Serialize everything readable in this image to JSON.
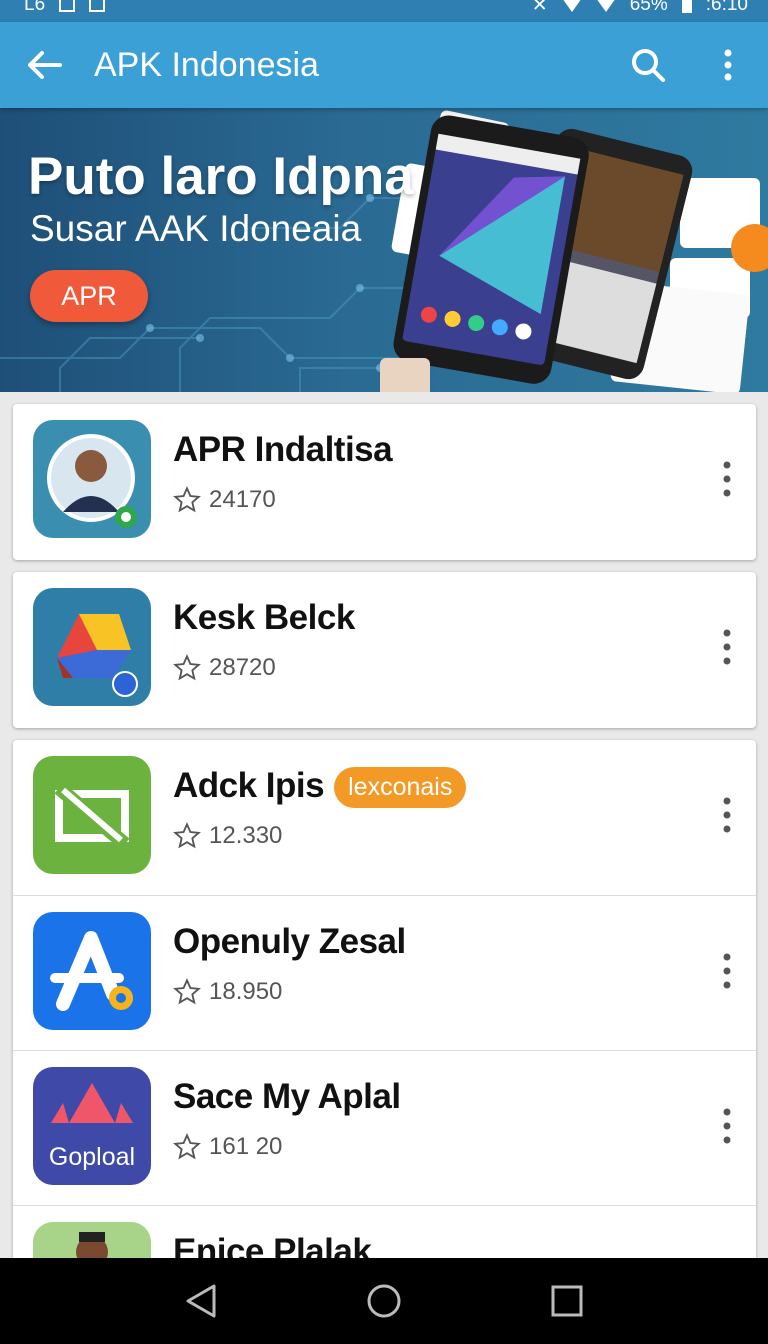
{
  "status_bar": {
    "left_text": "L6",
    "battery": "65%",
    "time": ":6:10"
  },
  "app_bar": {
    "title": "APK Indonesia",
    "back_icon": "arrow-back-icon",
    "search_icon": "search-icon",
    "more_icon": "more-vert-icon"
  },
  "banner": {
    "headline": "Puto laro Idpna",
    "subtitle": "Susar AAK Idoneaia",
    "cta_label": "APR"
  },
  "apps": [
    {
      "name": "APR Indaltisa",
      "rating": "24170",
      "badge": ""
    },
    {
      "name": "Kesk Belck",
      "rating": "28720",
      "badge": ""
    },
    {
      "name": "Adck Ipis",
      "rating": "12.330",
      "badge": "lexconais"
    },
    {
      "name": "Openuly Zesal",
      "rating": "18.950",
      "badge": ""
    },
    {
      "name": "Sace My Aplal",
      "rating": "161 20",
      "badge": "",
      "icon_text": "Goploal"
    },
    {
      "name": "Enice Plalak",
      "rating": "",
      "badge": ""
    }
  ],
  "colors": {
    "app_bar": "#3aa0d5",
    "status_bar": "#2f7fb3",
    "cta": "#f05a3a",
    "badge": "#f39a26"
  },
  "nav_bar": {
    "back_icon": "nav-back-icon",
    "home_icon": "nav-home-icon",
    "recents_icon": "nav-recents-icon"
  }
}
